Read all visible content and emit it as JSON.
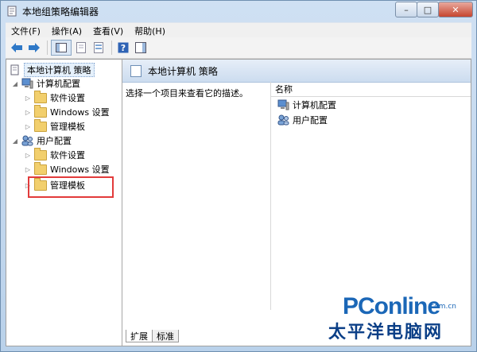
{
  "window": {
    "title": "本地组策略编辑器"
  },
  "menubar": {
    "items": [
      {
        "label": "文件(F)"
      },
      {
        "label": "操作(A)"
      },
      {
        "label": "查看(V)"
      },
      {
        "label": "帮助(H)"
      }
    ]
  },
  "tree": {
    "root": "本地计算机 策略",
    "computer_config": "计算机配置",
    "computer_children": [
      "软件设置",
      "Windows 设置",
      "管理模板"
    ],
    "user_config": "用户配置",
    "user_children": [
      "软件设置",
      "Windows 设置",
      "管理模板"
    ]
  },
  "right": {
    "header": "本地计算机 策略",
    "description": "选择一个项目来查看它的描述。",
    "column_name": "名称",
    "rows": [
      "计算机配置",
      "用户配置"
    ],
    "tabs": [
      "扩展",
      "标准"
    ]
  },
  "watermark": {
    "brand": "PConline",
    "domain": ".com.cn",
    "cn_name": "太平洋电脑网"
  },
  "colors": {
    "highlight": "#e23b3b",
    "brand_blue": "#1b67b7"
  }
}
